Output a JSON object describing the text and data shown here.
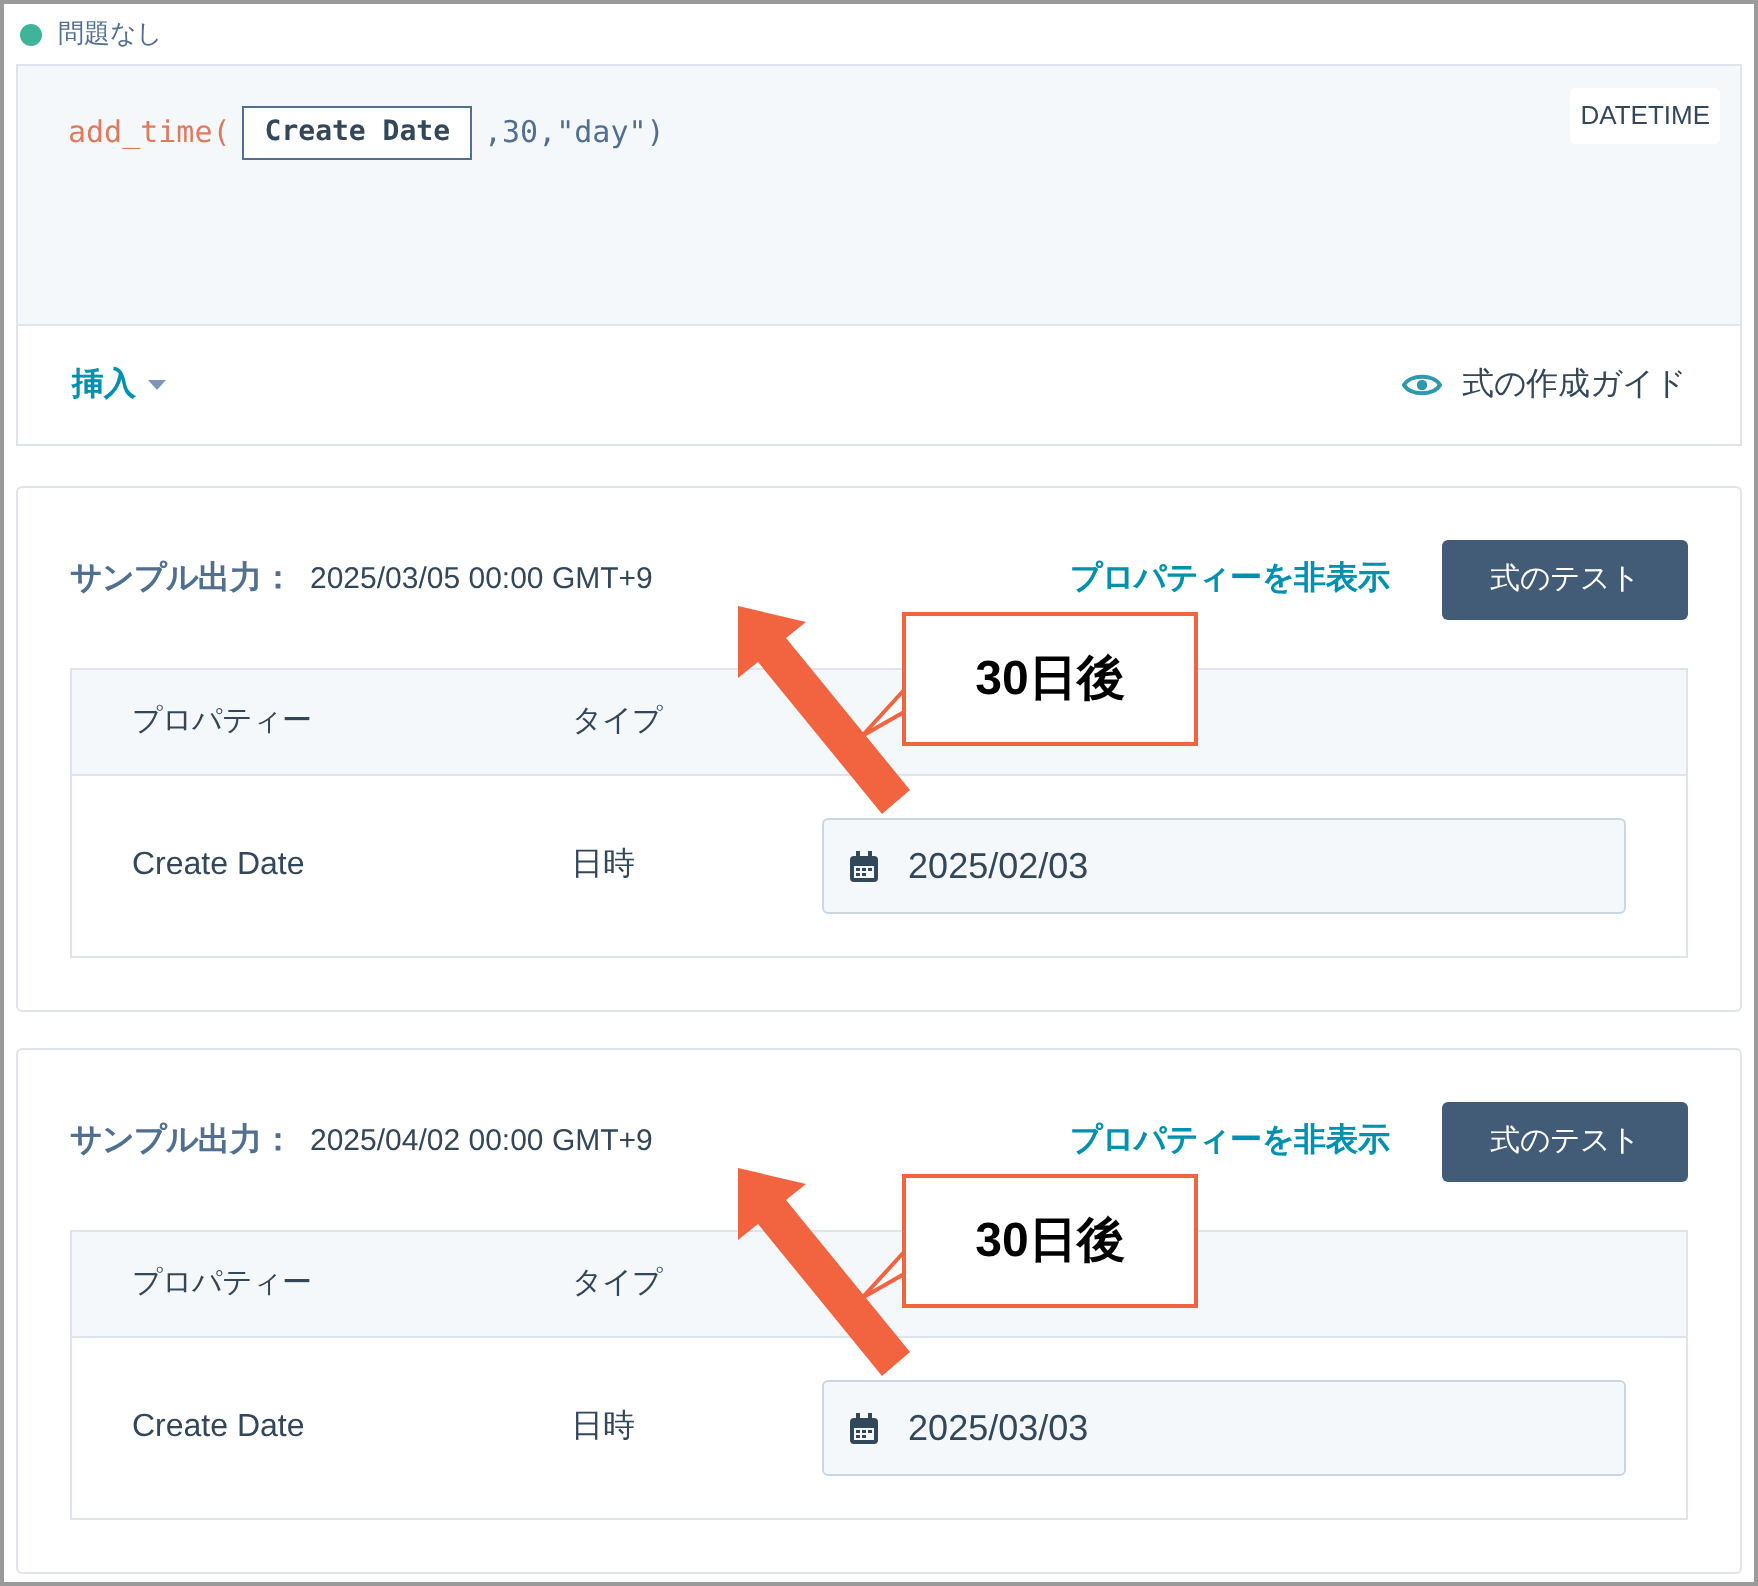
{
  "status": {
    "text": "問題なし"
  },
  "formula": {
    "tokens": [
      {
        "kind": "function",
        "text": "add_time("
      },
      {
        "kind": "property",
        "text": "Create Date"
      },
      {
        "kind": "args",
        "text": ",30,\"day\")"
      }
    ],
    "type_badge": "DATETIME"
  },
  "editor_footer": {
    "insert": "挿入",
    "guide": "式の作成ガイド"
  },
  "samples": [
    {
      "label": "サンプル出力：",
      "value": "2025/03/05 00:00 GMT+9",
      "toggle_link": "プロパティーを非表示",
      "test_button": "式のテスト",
      "columns": [
        "プロパティー",
        "タイプ"
      ],
      "rows": [
        {
          "property": "Create Date",
          "type": "日時",
          "value": "2025/02/03"
        }
      ],
      "annotation": "30日後"
    },
    {
      "label": "サンプル出力：",
      "value": "2025/04/02 00:00 GMT+9",
      "toggle_link": "プロパティーを非表示",
      "test_button": "式のテスト",
      "columns": [
        "プロパティー",
        "タイプ"
      ],
      "rows": [
        {
          "property": "Create Date",
          "type": "日時",
          "value": "2025/03/03"
        }
      ],
      "annotation": "30日後"
    }
  ]
}
